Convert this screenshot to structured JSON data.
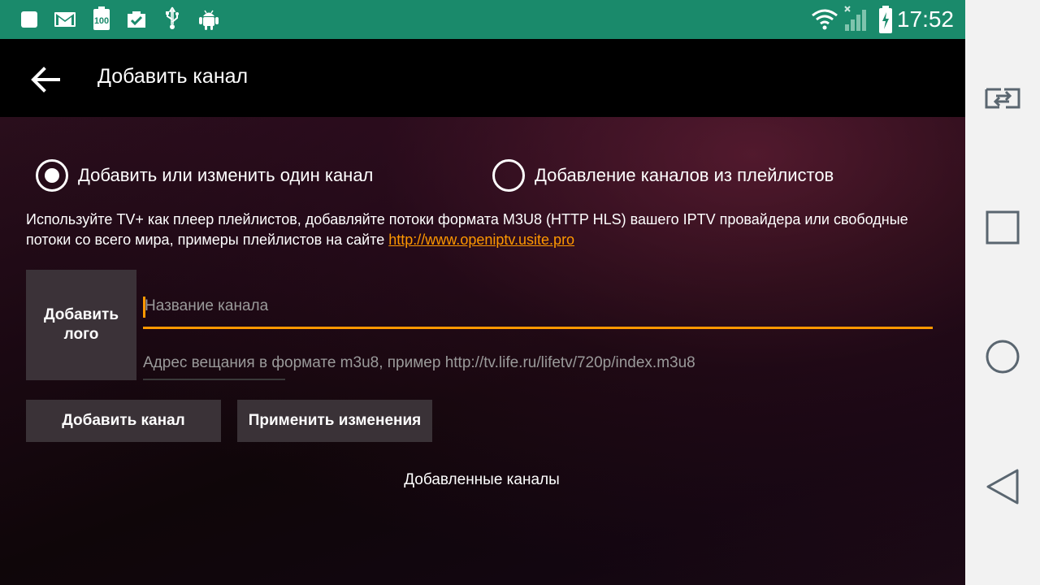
{
  "status_bar": {
    "time": "17:52",
    "battery_icon_text": "100",
    "background": "#1a8a6b",
    "icons": [
      "square-notification-icon",
      "gmail-icon",
      "battery-100-icon",
      "clipboard-check-icon",
      "usb-icon",
      "android-icon",
      "wifi-icon",
      "cellular-signal-icon",
      "battery-charging-icon"
    ]
  },
  "app_bar": {
    "title": "Добавить канал"
  },
  "mode": {
    "option_single": "Добавить или изменить один канал",
    "option_playlist": "Добавление каналов из плейлистов",
    "selected": "single"
  },
  "description": {
    "text": "Используйте TV+ как плеер плейлистов, добавляйте потоки формата M3U8 (HTTP HLS) вашего IPTV провайдера или свободные потоки со всего мира, примеры плейлистов на сайте ",
    "link": "http://www.openiptv.usite.pro"
  },
  "logo": {
    "label_line1": "Добавить",
    "label_line2": "лого"
  },
  "form": {
    "name_placeholder": "Название канала",
    "url_placeholder": "Адрес вещания в формате m3u8, пример http://tv.life.ru/lifetv/720p/index.m3u8"
  },
  "buttons": {
    "add_channel": "Добавить канал",
    "apply_changes": "Применить изменения"
  },
  "added_channels_title": "Добавленные каналы",
  "colors": {
    "accent": "#ff9800",
    "status_bar": "#1a8a6b",
    "button_bg": "#3a3237",
    "nav_bar": "#f2f2f2"
  }
}
